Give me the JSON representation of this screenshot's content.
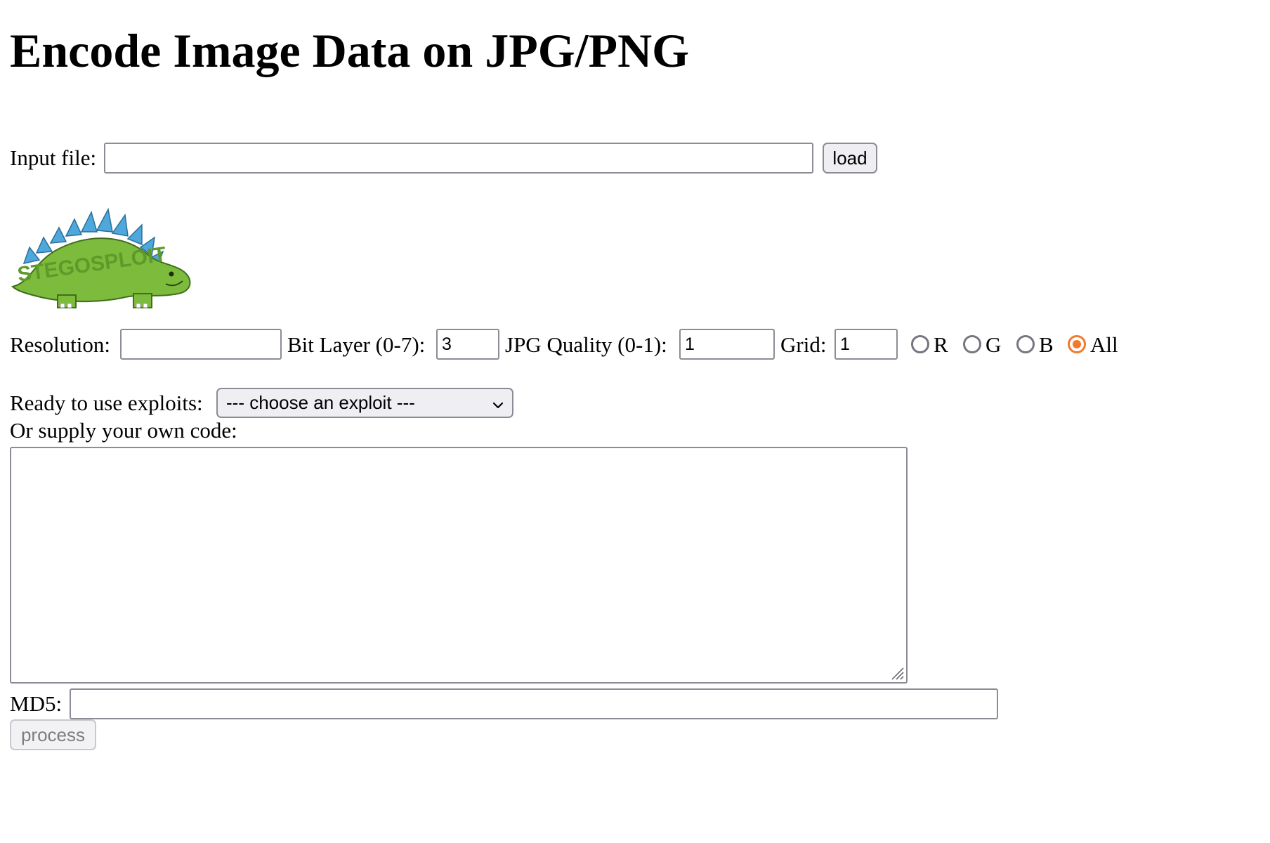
{
  "page": {
    "title": "Encode Image Data on JPG/PNG"
  },
  "input_file": {
    "label": "Input file:",
    "value": "",
    "load_button": "load"
  },
  "logo": {
    "text": "STEGOSPLOIT",
    "body_color": "#7dbb3c",
    "spike_color": "#4ea8dc"
  },
  "settings": {
    "resolution_label": "Resolution:",
    "resolution_value": "",
    "bit_layer_label": "Bit Layer (0-7):",
    "bit_layer_value": "3",
    "jpg_quality_label": "JPG Quality (0-1):",
    "jpg_quality_value": "1",
    "grid_label": "Grid:",
    "grid_value": "1",
    "channels": [
      {
        "label": "R",
        "checked": false
      },
      {
        "label": "G",
        "checked": false
      },
      {
        "label": "B",
        "checked": false
      },
      {
        "label": "All",
        "checked": true
      }
    ]
  },
  "exploits": {
    "label": "Ready to use exploits:",
    "selected": "--- choose an exploit ---",
    "own_code_label": "Or supply your own code:",
    "code_value": ""
  },
  "md5": {
    "label": "MD5:",
    "value": ""
  },
  "actions": {
    "process_button": "process"
  },
  "colors": {
    "radio_accent": "#f2792b",
    "border": "#8c8c96"
  }
}
